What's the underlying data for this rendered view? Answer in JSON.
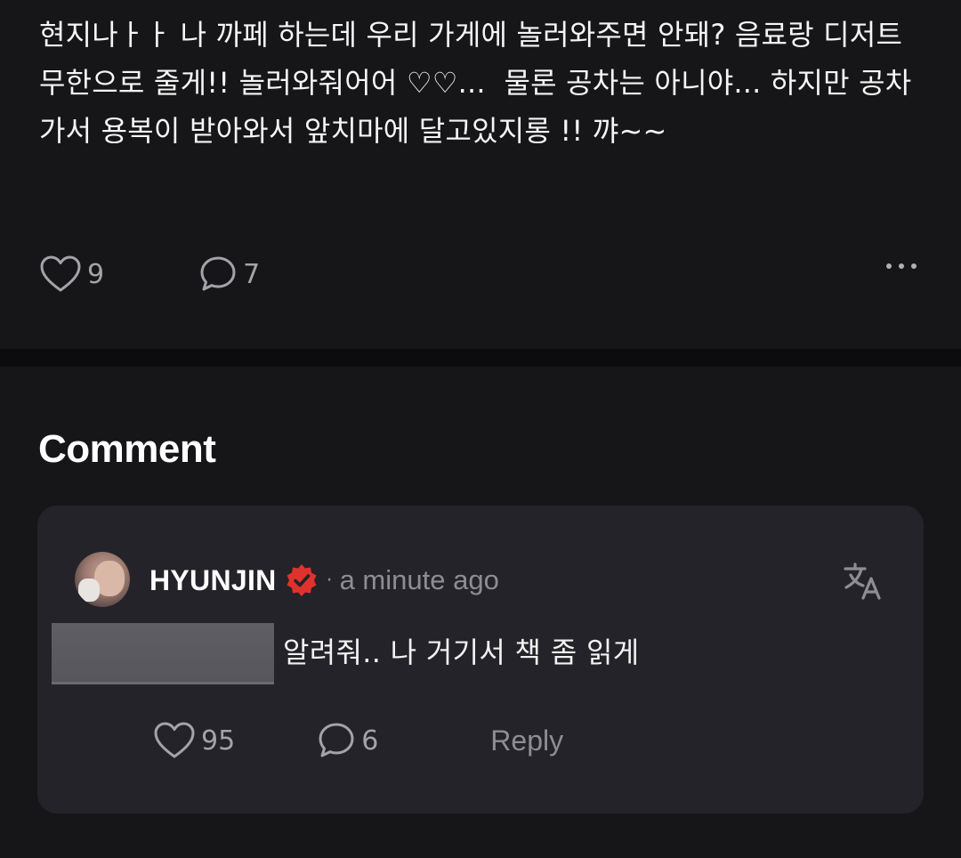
{
  "post": {
    "body": "현지나ㅏㅏ 나 까페 하는데 우리 가게에 놀러와주면 안돼? 음료랑 디저트 무한으로 줄게!! 놀러와줘어어 ♡♡...  물론 공차는 아니야... 하지만 공차가서 용복이 받아와서 앞치마에 달고있지롱 !! 꺄~~",
    "like_count": "9",
    "comment_count": "7"
  },
  "comments_section": {
    "title": "Comment"
  },
  "comment": {
    "author": "HYUNJIN",
    "separator": "·",
    "timestamp": "a minute ago",
    "text": "알려줘.. 나 거기서 책 좀 읽게",
    "like_count": "95",
    "reply_count": "6",
    "reply_label": "Reply"
  },
  "colors": {
    "background": "#16161a",
    "card": "#232329",
    "verified_badge": "#e0322c",
    "muted_text": "#8d8d93"
  },
  "icons": [
    "heart-icon",
    "comment-bubble-icon",
    "more-dots-icon",
    "verified-badge-icon",
    "translate-icon"
  ]
}
